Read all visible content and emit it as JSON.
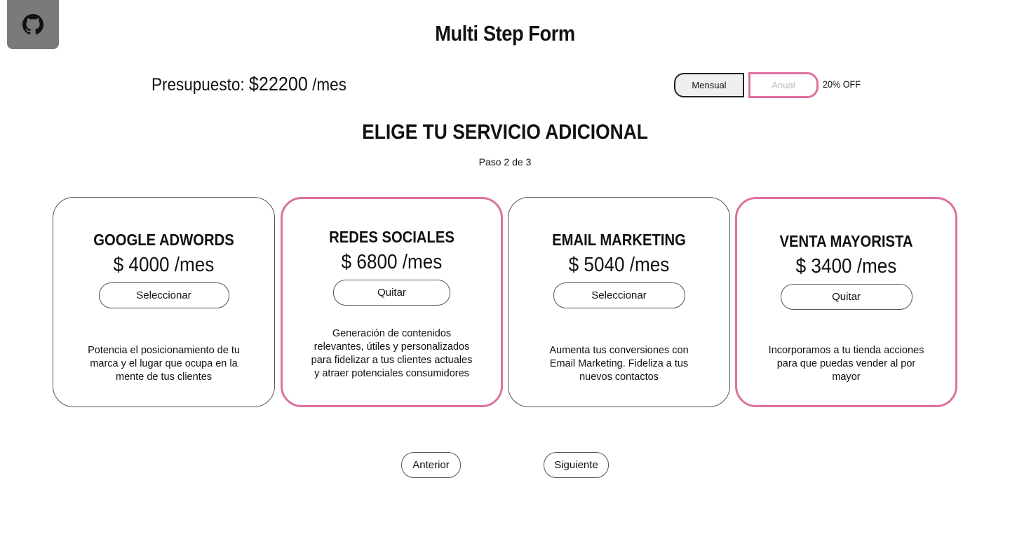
{
  "header": {
    "github_icon": "github-icon",
    "title": "Multi Step Form"
  },
  "budget": {
    "label": "Presupuesto: ",
    "amount": "$22200",
    "unit": " /mes"
  },
  "billing": {
    "monthly_label": "Mensual",
    "yearly_label": "Anual",
    "discount": "20% OFF",
    "selected": "Mensual"
  },
  "section": {
    "title": "ELIGE TU SERVICIO ADICIONAL",
    "step": "Paso 2 de 3"
  },
  "cards": [
    {
      "name": "GOOGLE ADWORDS",
      "price": "$ 4000 /mes",
      "button": "Seleccionar",
      "description": "Potencia el posicionamiento de tu marca y el lugar que ocupa en la mente de tus clientes",
      "selected": false
    },
    {
      "name": "REDES SOCIALES",
      "price": "$ 6800 /mes",
      "button": "Quitar",
      "description": "Generación de contenidos relevantes, útiles y personalizados para fidelizar a tus clientes actuales y atraer potenciales consumidores",
      "selected": true
    },
    {
      "name": "EMAIL MARKETING",
      "price": "$ 5040 /mes",
      "button": "Seleccionar",
      "description": "Aumenta tus conversiones con Email Marketing. Fideliza a tus nuevos contactos",
      "selected": false
    },
    {
      "name": "VENTA MAYORISTA",
      "price": "$ 3400 /mes",
      "button": "Quitar",
      "description": "Incorporamos a tu tienda acciones para que puedas vender al por mayor",
      "selected": true
    }
  ],
  "nav": {
    "previous": "Anterior",
    "next": "Siguiente"
  },
  "colors": {
    "accent": "#dc72a0",
    "github_bg": "#7a7a7a"
  }
}
